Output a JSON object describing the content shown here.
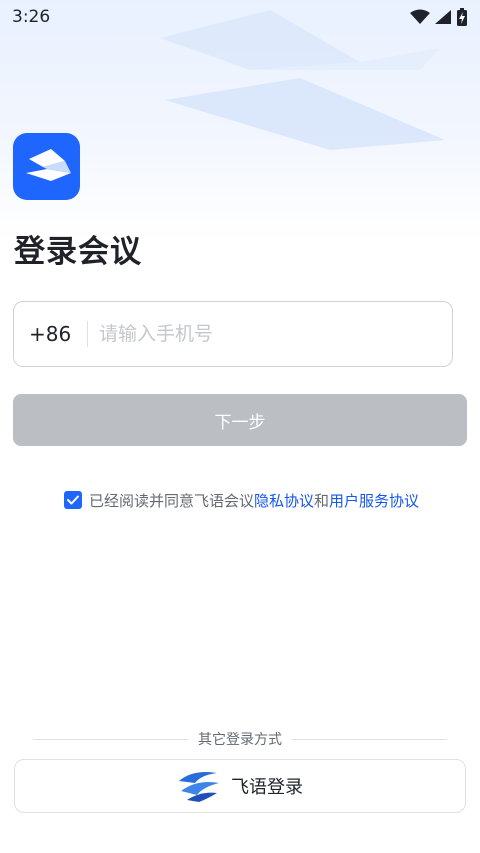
{
  "status_bar": {
    "time": "3:26",
    "icons": [
      "wifi-icon",
      "signal-icon",
      "battery-icon"
    ]
  },
  "app": {
    "logo_icon": "paper-plane-logo-icon",
    "brand_color": "#1f66ff"
  },
  "page": {
    "title": "登录会议"
  },
  "phone": {
    "country_code": "+86",
    "placeholder": "请输入手机号",
    "value": ""
  },
  "next_button": {
    "label": "下一步",
    "enabled": false,
    "color": "#bbbfc4"
  },
  "agreement": {
    "checked": true,
    "prefix": "已经阅读并同意飞语会议",
    "privacy_link": "隐私协议",
    "and": "和",
    "service_link": "用户服务协议",
    "link_color": "#1456f0"
  },
  "other_login": {
    "label": "其它登录方式",
    "feishu_label": "飞语登录",
    "feishu_icon": "feiyu-logo-icon"
  }
}
